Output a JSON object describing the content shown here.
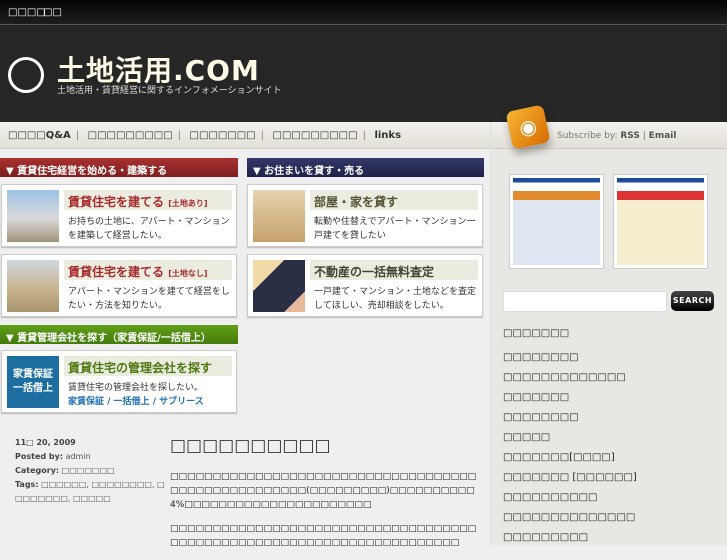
{
  "topbar": {
    "links": [
      "□□□□",
      "□□"
    ]
  },
  "header": {
    "title": "土地活用.COM",
    "subtitle": "土地活用・賃貸経営に関するインフォメーションサイト",
    "logo_ring_text": "tochikatuyou-dot-com"
  },
  "nav": {
    "items": [
      "□□□□Q&A",
      "□□□□□□□□□",
      "□□□□□□□",
      "□□□□□□□□□",
      "links"
    ]
  },
  "sections": [
    {
      "label": "▼ 賃貸住宅経営を始める・建築する",
      "color": "#8e2424"
    },
    {
      "label": "▼ お住まいを貸す・売る",
      "color": "#262a55"
    },
    {
      "label": "▼ 賃貸管理会社を探す（家賃保証/一括借上）",
      "color": "#4f8a12"
    }
  ],
  "cards": [
    {
      "title": "賃貸住宅を建てる",
      "tag": "[土地あり]",
      "desc": "お持ちの土地に、アパート・マンションを建築して経営したい。",
      "color": "#a52a2a"
    },
    {
      "title": "賃貸住宅を建てる",
      "tag": "[土地なし]",
      "desc": "アパート・マンションを建てて経営をしたい・方法を知りたい。",
      "color": "#a52a2a"
    },
    {
      "title": "部屋・家を貸す",
      "tag": "",
      "desc": "転勤や住替えでアパート・マンション一戸建てを貸したい",
      "color": "#555533"
    },
    {
      "title": "不動産の一括無料査定",
      "tag": "",
      "desc": "一戸建て・マンション・土地などを査定してほしい、売却相談をしたい。",
      "color": "#444433"
    },
    {
      "title": "賃貸住宅の管理会社を探す",
      "tag": "",
      "desc": "賃貸住宅の管理会社を探したい。",
      "links": "家賃保証 / 一括借上 / サブリース",
      "img_text": "家賃保証 一括借上",
      "color": "#4f7a12"
    }
  ],
  "post": {
    "date": "11□ 20, 2009",
    "posted_by_label": "Posted by:",
    "author": "admin",
    "category_label": "Category:",
    "category": "□□□□□□□",
    "tags_label": "Tags:",
    "tags": "□□□□□□, □□□□□□□□, □□□□□□□□, □□□□□",
    "title": "□□□□□□□□□□",
    "p1": "□□□□□□□□□□□□□□□□□□□□□□□□□□□□□□□□□□□□□□□□□□□□□□□□□□□□(□□□□□□□□□)□□□□□□□□□□4%□□□□□□□□□□□□□□□□□□□□□□",
    "p2": "□□□□□□□□□□□□□□□□□□□□□□□□□□□□□□□□□□□□□□□□□□□□□□□□□□□□□□□□□□□□□□□□□□□□□□"
  },
  "sidebar": {
    "subscribe_label": "Subscribe by:",
    "rss": "RSS",
    "sep": "|",
    "email": "Email",
    "search_button": "SEARCH",
    "heading": "□□□□□□□",
    "items": [
      "□□□□□□□□",
      "□□□□□□□□□□□□□",
      "□□□□□□□",
      "□□□□□□□□",
      "□□□□□",
      "□□□□□□□[□□□□]",
      "□□□□□□□ [□□□□□□]",
      "□□□□□□□□□□",
      "□□□□□□□□□□□□□□",
      "□□□□□□□□□"
    ]
  }
}
